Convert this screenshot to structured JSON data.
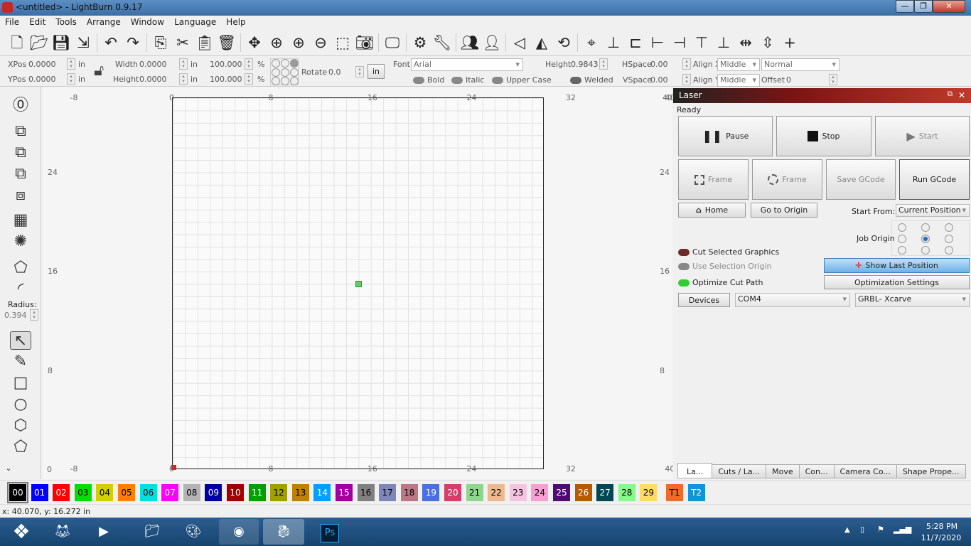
{
  "window": {
    "title": "<untitled> - LightBurn 0.9.17",
    "min": "—",
    "max": "❐",
    "close": "✕"
  },
  "menu": [
    "File",
    "Edit",
    "Tools",
    "Arrange",
    "Window",
    "Language",
    "Help"
  ],
  "toolbar_icons": [
    "new-file-icon",
    "open-folder-icon",
    "save-icon",
    "import-icon",
    "undo-icon",
    "redo-icon",
    "copy-icon",
    "cut-icon",
    "paste-icon",
    "delete-icon",
    "move-icon",
    "zoom-fit-icon",
    "zoom-in-icon",
    "zoom-out-icon",
    "select-frame-icon",
    "camera-icon",
    "monitor-icon",
    "settings-icon",
    "tools-icon",
    "group-icon",
    "ungroup-icon",
    "mirror-vertical-icon",
    "mirror-horizontal-icon",
    "rotate-icon",
    "center-icon",
    "align-icon",
    "distribute-icon",
    "align-left-icon",
    "align-right-icon",
    "align-top-icon",
    "align-bottom-icon",
    "distribute-h-icon",
    "distribute-v-icon",
    "move-together-icon"
  ],
  "props": {
    "xpos_label": "XPos",
    "xpos": "0.0000",
    "ypos_label": "YPos",
    "ypos": "0.0000",
    "unit": "in",
    "width_label": "Width",
    "width": "0.0000",
    "height_label": "Height",
    "height": "0.0000",
    "scale_x": "100.000",
    "scale_y": "100.000",
    "pct": "%",
    "rotate_label": "Rotate",
    "rotate": "0.0",
    "unit_btn": "in",
    "font_label": "Font",
    "font": "Arial",
    "text_height_label": "Height",
    "text_height": "0.9843",
    "hspace_label": "HSpace",
    "hspace": "0.00",
    "vspace_label": "VSpace",
    "vspace": "0.00",
    "alignx_label": "Align X",
    "alignx": "Middle",
    "aligny_label": "Align Y",
    "aligny": "Middle",
    "mode": "Normal",
    "offset_label": "Offset",
    "offset": "0",
    "bold": "Bold",
    "italic": "Italic",
    "upper": "Upper Case",
    "welded": "Welded"
  },
  "left_tools": {
    "radius_label": "Radius:",
    "radius": "0.394"
  },
  "rulers": {
    "top": [
      "-8",
      "0",
      "8",
      "16",
      "24",
      "32",
      "40"
    ],
    "left": [
      "24",
      "16",
      "8",
      "0"
    ],
    "right": [
      "24",
      "16",
      "8"
    ],
    "bottom": [
      "-8",
      "0",
      "8",
      "16",
      "24",
      "32",
      "40"
    ],
    "corner_right": "40"
  },
  "bed": {
    "size_in": [
      30,
      30
    ],
    "object_pos_in": [
      15,
      15
    ],
    "object_color": "#66cc66"
  },
  "laser": {
    "title": "Laser",
    "status": "Ready",
    "pause": "Pause",
    "stop": "Stop",
    "start": "Start",
    "frame1": "Frame",
    "frame2": "Frame",
    "save_gcode": "Save GCode",
    "run_gcode": "Run GCode",
    "home": "Home",
    "go_origin": "Go to Origin",
    "start_from_label": "Start From:",
    "start_from": "Current Position",
    "job_origin_label": "Job Origin",
    "job_origin_selected": "center",
    "cut_selected": "Cut Selected Graphics",
    "use_selection_origin": "Use Selection Origin",
    "optimize": "Optimize Cut Path",
    "show_last": "Show Last Position",
    "opt_settings": "Optimization Settings",
    "devices": "Devices",
    "port": "COM4",
    "device": "GRBL- Xcarve"
  },
  "tabs": [
    "La...",
    "Cuts / La...",
    "Move",
    "Con...",
    "Camera Co...",
    "Shape Prope..."
  ],
  "palette": [
    [
      "00",
      "#000000",
      "#fff"
    ],
    [
      "01",
      "#0000ff",
      "#fff"
    ],
    [
      "02",
      "#ff0000",
      "#fff"
    ],
    [
      "03",
      "#00e000",
      "#000"
    ],
    [
      "04",
      "#d0d000",
      "#000"
    ],
    [
      "05",
      "#ff8000",
      "#000"
    ],
    [
      "06",
      "#00e0e0",
      "#000"
    ],
    [
      "07",
      "#ff00ff",
      "#fff"
    ],
    [
      "08",
      "#b4b4b4",
      "#000"
    ],
    [
      "09",
      "#0000a0",
      "#fff"
    ],
    [
      "10",
      "#a00000",
      "#fff"
    ],
    [
      "11",
      "#00a000",
      "#fff"
    ],
    [
      "12",
      "#a0a000",
      "#000"
    ],
    [
      "13",
      "#c08000",
      "#000"
    ],
    [
      "14",
      "#00a0ff",
      "#fff"
    ],
    [
      "15",
      "#a000a0",
      "#fff"
    ],
    [
      "16",
      "#808080",
      "#000"
    ],
    [
      "17",
      "#7d87b9",
      "#000"
    ],
    [
      "18",
      "#bb7784",
      "#000"
    ],
    [
      "19",
      "#4a6fe3",
      "#fff"
    ],
    [
      "20",
      "#d33f6a",
      "#fff"
    ],
    [
      "21",
      "#8cd78c",
      "#000"
    ],
    [
      "22",
      "#f0b98d",
      "#000"
    ],
    [
      "23",
      "#f6c4e1",
      "#000"
    ],
    [
      "24",
      "#fa9ed4",
      "#000"
    ],
    [
      "25",
      "#500a78",
      "#fff"
    ],
    [
      "26",
      "#b45a00",
      "#fff"
    ],
    [
      "27",
      "#004754",
      "#fff"
    ],
    [
      "28",
      "#86fa88",
      "#000"
    ],
    [
      "29",
      "#ffdb66",
      "#000"
    ],
    [
      "T1",
      "#f36926",
      "#000"
    ],
    [
      "T2",
      "#0f95d8",
      "#fff"
    ]
  ],
  "status": "x: 40.070, y: 16.272 in",
  "taskbar": {
    "time": "5:28 PM",
    "date": "11/7/2020",
    "apps": [
      "start-orb",
      "firefox",
      "media-player",
      "file-explorer",
      "paint-app",
      "chrome",
      "lightburn",
      "photoshop"
    ]
  }
}
